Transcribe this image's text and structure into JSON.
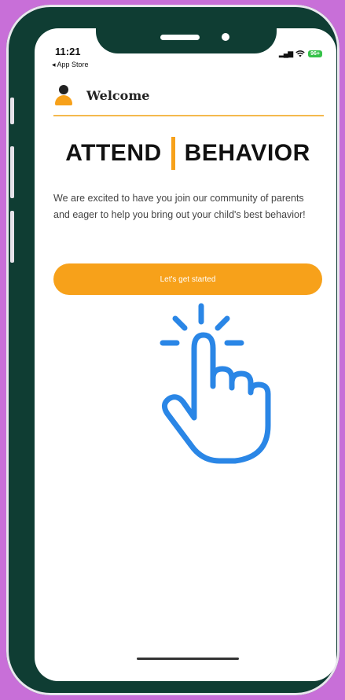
{
  "status_bar": {
    "time": "11:21",
    "back_label": "◂ App Store",
    "signal": "▂▄▆",
    "battery": "96+"
  },
  "header": {
    "title": "Welcome"
  },
  "brand": {
    "left": "ATTEND",
    "right": "BEHAVIOR",
    "accent_color": "#f7a11a"
  },
  "intro_text": "We are excited to have you join our community of parents and eager to help you bring out your child's best behavior!",
  "cta": {
    "label": "Let's get started"
  },
  "icons": [
    "user-avatar-icon",
    "wifi-icon",
    "battery-icon",
    "tap-hand-icon"
  ]
}
